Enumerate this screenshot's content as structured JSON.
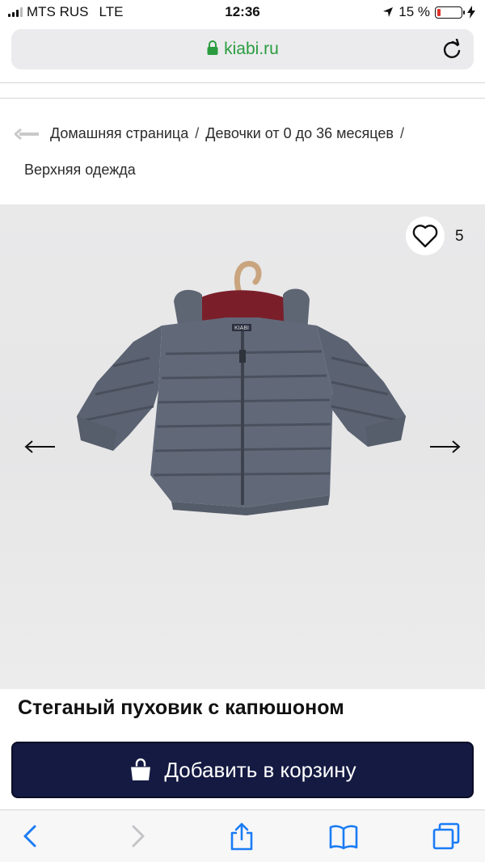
{
  "status_bar": {
    "carrier": "MTS RUS",
    "network": "LTE",
    "time": "12:36",
    "battery_text": "15 %",
    "battery_level": 0.15,
    "battery_color": "#e0332b"
  },
  "url_bar": {
    "domain": "kiabi.ru",
    "icons": [
      "lock-icon",
      "reload-icon"
    ],
    "accent": "#2a9c3f"
  },
  "breadcrumb": {
    "items": [
      "Домашняя страница",
      "Девочки от 0 до 36 месяцев",
      "Верхняя одежда"
    ],
    "separator": "/"
  },
  "product": {
    "favorites_count": "5",
    "title": "Стеганый пуховик с капюшоном",
    "jacket_label": "KIABI",
    "add_to_cart_label": "Добавить в корзину",
    "button_color": "#141a42"
  },
  "toolbar": {
    "icons": [
      "back-icon",
      "forward-icon",
      "share-icon",
      "bookmarks-icon",
      "tabs-icon"
    ],
    "color": "#1a7cf5"
  }
}
